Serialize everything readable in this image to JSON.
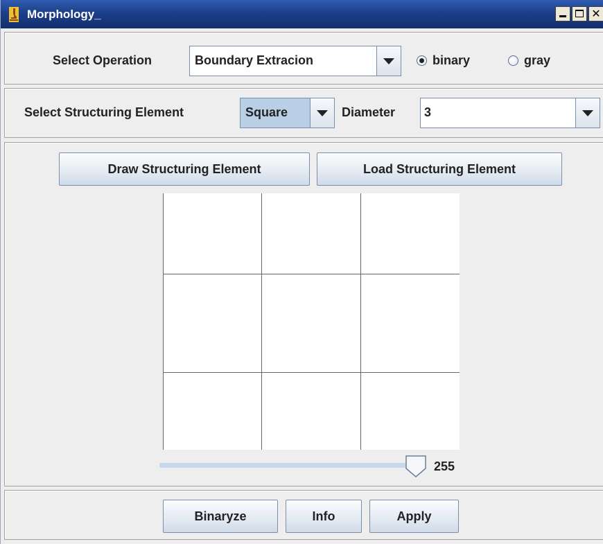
{
  "window": {
    "title": "Morphology_"
  },
  "operation": {
    "label": "Select Operation",
    "selected": "Boundary Extracion",
    "modes": [
      {
        "label": "binary",
        "selected": true
      },
      {
        "label": "gray",
        "selected": false
      }
    ]
  },
  "structuring": {
    "label": "Select Structuring Element",
    "shape": "Square",
    "diameter_label": "Diameter",
    "diameter": "3"
  },
  "buttons": {
    "draw": "Draw Structuring Element",
    "load": "Load Structuring Element",
    "binaryze": "Binaryze",
    "info": "Info",
    "apply": "Apply"
  },
  "grid": {
    "rows": 3,
    "cols": 3
  },
  "slider": {
    "value": "255",
    "fraction": 0.98
  },
  "colors": {
    "titlebar": "#1d3f8a",
    "selected_combo": "#b8cfe5"
  }
}
